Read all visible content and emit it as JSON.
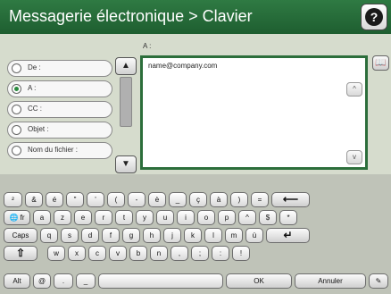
{
  "header": {
    "title": "Messagerie électronique > Clavier",
    "help_glyph": "?"
  },
  "fields": [
    {
      "label": "De :",
      "checked": false
    },
    {
      "label": "A :",
      "checked": true
    },
    {
      "label": "CC :",
      "checked": false
    },
    {
      "label": "Objet :",
      "checked": false
    },
    {
      "label": "Nom du fichier :",
      "checked": false
    }
  ],
  "editor": {
    "label": "A :",
    "value": "name@company.com"
  },
  "keyboard": {
    "row1": [
      "²",
      "&",
      "é",
      "\"",
      "'",
      "(",
      "-",
      "è",
      "_",
      "ç",
      "à",
      ")",
      "=",
      "⟵"
    ],
    "row2": [
      "fr",
      "a",
      "z",
      "e",
      "r",
      "t",
      "y",
      "u",
      "i",
      "o",
      "p",
      "^",
      "$",
      "*"
    ],
    "row3": [
      "Caps",
      "q",
      "s",
      "d",
      "f",
      "g",
      "h",
      "j",
      "k",
      "l",
      "m",
      "ù",
      "↵"
    ],
    "row4": [
      "⇧",
      "w",
      "x",
      "c",
      "v",
      "b",
      "n",
      ",",
      ";",
      ":",
      "!"
    ],
    "row5": [
      "Alt",
      "@",
      ".",
      "_",
      "",
      "OK",
      "Annuler",
      "✎"
    ]
  },
  "icons": {
    "help": "help-icon",
    "scroll_up": "chevron-up-icon",
    "scroll_down": "chevron-down-icon",
    "address_book": "address-book-icon",
    "globe": "globe-icon",
    "backspace": "backspace-icon",
    "enter": "enter-icon",
    "shift": "shift-icon",
    "clear": "eraser-icon"
  },
  "colors": {
    "header": "#2f7a43",
    "accent_border": "#2c6e3b",
    "radio_checked": "#2a8a3e"
  }
}
